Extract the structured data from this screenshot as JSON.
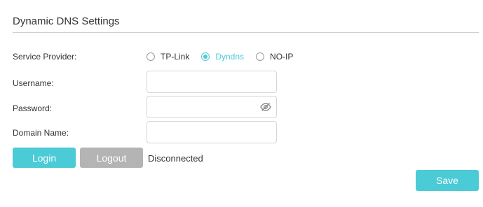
{
  "section": {
    "title": "Dynamic DNS Settings"
  },
  "service_provider": {
    "label": "Service Provider:",
    "options": [
      {
        "label": "TP-Link",
        "selected": false
      },
      {
        "label": "Dyndns",
        "selected": true
      },
      {
        "label": "NO-IP",
        "selected": false
      }
    ]
  },
  "username": {
    "label": "Username:",
    "value": "",
    "placeholder": ""
  },
  "password": {
    "label": "Password:",
    "value": "",
    "placeholder": "",
    "icon": "eye-slash-icon"
  },
  "domain_name": {
    "label": "Domain Name:",
    "value": "",
    "placeholder": ""
  },
  "buttons": {
    "login": "Login",
    "logout": "Logout",
    "save": "Save"
  },
  "status": "Disconnected",
  "colors": {
    "accent": "#4acbd6",
    "disabled": "#b4b4b4",
    "text": "#333333",
    "rule": "#cfcfcf"
  }
}
